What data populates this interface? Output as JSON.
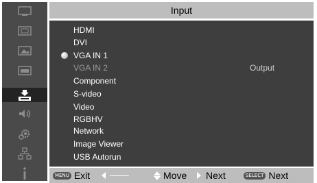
{
  "title": "Input",
  "sidebar": {
    "icons": [
      "picture-adjust-icon",
      "screen-setting-icon",
      "image-icon",
      "pc-adjust-icon",
      "input-icon",
      "sound-icon",
      "setting-icon",
      "network-icon",
      "information-icon"
    ],
    "selected": "input-icon"
  },
  "menu": {
    "items": [
      {
        "label": "HDMI"
      },
      {
        "label": "DVI"
      },
      {
        "label": "VGA  IN 1",
        "selected": true
      },
      {
        "label": "VGA  IN 2",
        "disabled": true
      },
      {
        "label": "Component"
      },
      {
        "label": "S-video"
      },
      {
        "label": "Video"
      },
      {
        "label": "RGBHV"
      },
      {
        "label": "Network"
      },
      {
        "label": "Image Viewer"
      },
      {
        "label": "USB Autorun"
      }
    ],
    "output_label": "Output"
  },
  "bottom": {
    "menu_key": "MENU",
    "exit_label": "Exit",
    "move_label": "Move",
    "next_label": "Next",
    "select_key": "SELECT",
    "select_next_label": "Next"
  },
  "colors": {
    "panel": "#3e3e3e",
    "bar": "#bdbdbd",
    "sidebar": "#4a4a4a",
    "text": "#ffffff",
    "disabled_text": "#9a9a9a"
  }
}
